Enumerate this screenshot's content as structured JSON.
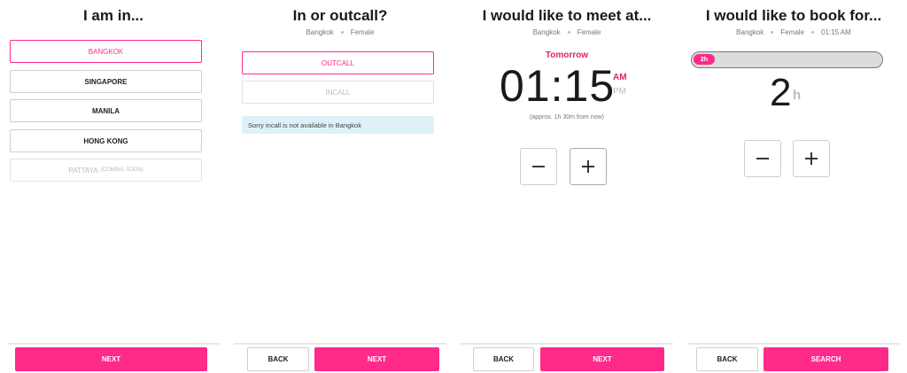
{
  "city_step": {
    "title": "I am in...",
    "options": [
      {
        "label": "BANGKOK"
      },
      {
        "label": "SINGAPORE"
      },
      {
        "label": "MANILA"
      },
      {
        "label": "HONG KONG"
      },
      {
        "label": "PATTAYA",
        "note": "(COMING SOON)"
      }
    ],
    "next_label": "NEXT"
  },
  "service_step": {
    "title": "In or outcall?",
    "crumbs": [
      "Bangkok",
      "Female"
    ],
    "options": [
      {
        "label": "OUTCALL"
      },
      {
        "label": "INCALL"
      }
    ],
    "notice": "Sorry incall is not available in Bangkok",
    "back_label": "BACK",
    "next_label": "NEXT"
  },
  "time_step": {
    "title": "I would like to meet at...",
    "crumbs": [
      "Bangkok",
      "Female"
    ],
    "day": "Tomorrow",
    "time": "01:15",
    "am": "AM",
    "pm": "PM",
    "approx": "(approx. 1h 30m from now)",
    "back_label": "BACK",
    "next_label": "NEXT"
  },
  "duration_step": {
    "title": "I would like to book for...",
    "crumbs": [
      "Bangkok",
      "Female",
      "01:15 AM"
    ],
    "progress_label": "2h",
    "progress_fraction": 0.11,
    "hours": "2",
    "unit": "h",
    "back_label": "BACK",
    "search_label": "SEARCH"
  },
  "colors": {
    "accent": "#ff2a8a",
    "accent_text": "#e0206f",
    "notice_bg": "#dff1f8"
  }
}
